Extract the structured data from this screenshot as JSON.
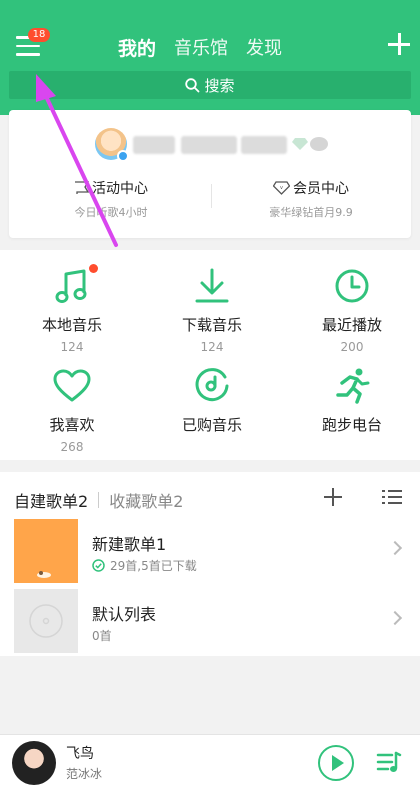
{
  "header": {
    "notification_count": "18",
    "tabs": [
      {
        "label": "我的",
        "active": true
      },
      {
        "label": "音乐馆",
        "active": false
      },
      {
        "label": "发现",
        "active": false
      }
    ],
    "search_placeholder": "搜索"
  },
  "profile": {
    "activity": {
      "title": "活动中心",
      "subtitle": "今日听歌4小时"
    },
    "vip": {
      "title": "会员中心",
      "subtitle": "豪华绿钻首月9.9"
    }
  },
  "grid": [
    {
      "label": "本地音乐",
      "count": "124",
      "icon": "music-note-icon",
      "has_dot": true
    },
    {
      "label": "下载音乐",
      "count": "124",
      "icon": "download-icon"
    },
    {
      "label": "最近播放",
      "count": "200",
      "icon": "clock-icon"
    },
    {
      "label": "我喜欢",
      "count": "268",
      "icon": "heart-icon"
    },
    {
      "label": "已购音乐",
      "count": "",
      "icon": "purchased-music-icon"
    },
    {
      "label": "跑步电台",
      "count": "",
      "icon": "running-icon"
    }
  ],
  "playlists": {
    "tabs": [
      {
        "label": "自建歌单2",
        "active": true
      },
      {
        "label": "收藏歌单2",
        "active": false
      }
    ],
    "items": [
      {
        "name": "新建歌单1",
        "meta": "29首,5首已下载",
        "downloaded_icon": true
      },
      {
        "name": "默认列表",
        "meta": "0首",
        "downloaded_icon": false
      }
    ]
  },
  "player": {
    "title": "飞鸟",
    "artist": "范冰冰"
  },
  "colors": {
    "accent": "#31c27c",
    "badge": "#ff4d2e",
    "annotation_arrow": "#d946ef"
  }
}
